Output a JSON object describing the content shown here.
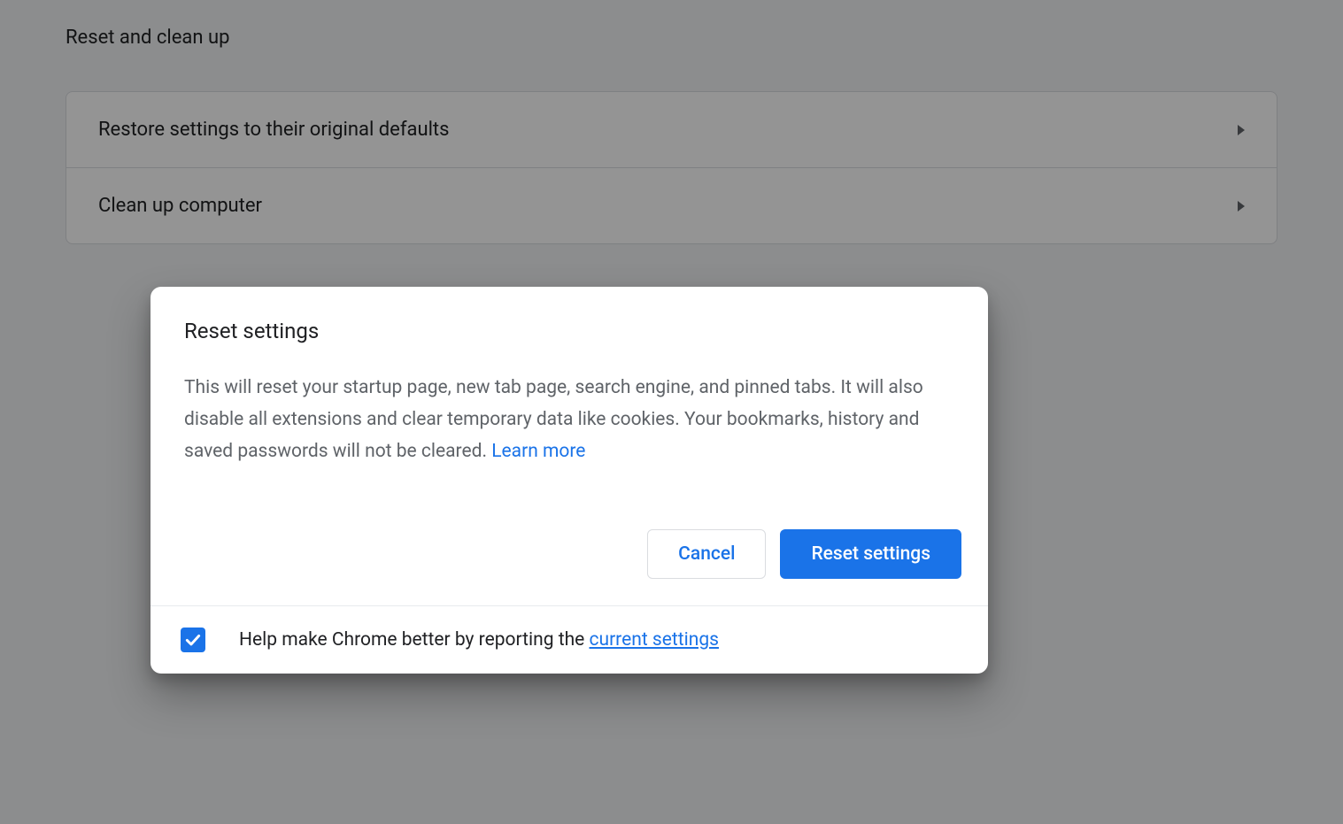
{
  "section": {
    "title": "Reset and clean up",
    "rows": [
      {
        "label": "Restore settings to their original defaults"
      },
      {
        "label": "Clean up computer"
      }
    ]
  },
  "dialog": {
    "title": "Reset settings",
    "description": "This will reset your startup page, new tab page, search engine, and pinned tabs. It will also disable all extensions and clear temporary data like cookies. Your bookmarks, history and saved passwords will not be cleared. ",
    "learn_more": "Learn more",
    "cancel_label": "Cancel",
    "confirm_label": "Reset settings",
    "footer_text": "Help make Chrome better by reporting the ",
    "footer_link": "current settings",
    "checkbox_checked": true
  }
}
